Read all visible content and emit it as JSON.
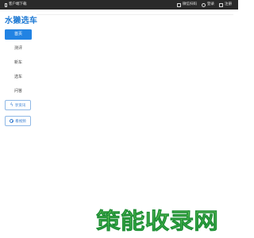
{
  "topbar": {
    "left_label": "客户端下载",
    "right_items": [
      {
        "icon": "square-icon",
        "label": "微信扫码"
      },
      {
        "icon": "user-icon",
        "label": "登录"
      },
      {
        "icon": "square-icon",
        "label": "注册"
      }
    ]
  },
  "logo": {
    "text": "水獭选车"
  },
  "nav": {
    "items": [
      {
        "label": "首页",
        "active": true
      },
      {
        "label": "测评"
      },
      {
        "label": "新车"
      },
      {
        "label": "选车"
      },
      {
        "label": "问答"
      }
    ]
  },
  "side_buttons": [
    {
      "icon": "bolt-icon",
      "label": "享资讯"
    },
    {
      "icon": "play-circle-icon",
      "label": "看视频"
    }
  ],
  "watermark": {
    "text": "策能收录网",
    "colors": {
      "top": "#9be36b",
      "bottom": "#2fb54a",
      "stroke": "#1e8e35"
    }
  },
  "colors": {
    "accent": "#2283e3",
    "topbar": "#2a2a2a",
    "logo": "#1f7ad4"
  }
}
